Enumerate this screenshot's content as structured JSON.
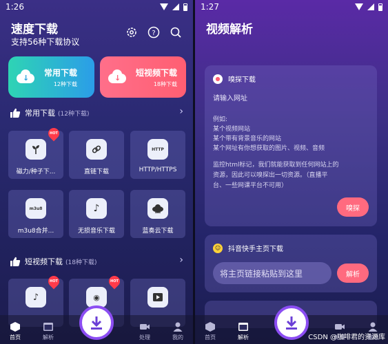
{
  "left": {
    "status": {
      "time": "1:26"
    },
    "header": {
      "title": "速度下载",
      "subtitle": "支持56种下载协议"
    },
    "header_icons": [
      "settings-icon",
      "help-icon",
      "search-icon"
    ],
    "big_cards": [
      {
        "title": "常用下载",
        "count": "12种下载",
        "color": "#2ed4b4"
      },
      {
        "title": "短视频下载",
        "count": "18种下载",
        "color": "#ff5e72"
      }
    ],
    "section1": {
      "title": "常用下载",
      "count": "(12种下载)"
    },
    "items_row1": [
      {
        "label": "磁力/种子下...",
        "icon": "sprout-icon",
        "hot": true
      },
      {
        "label": "直链下载",
        "icon": "link-icon",
        "hot": false
      },
      {
        "label": "HTTP/HTTPS",
        "icon": "http-icon",
        "icon_text": "HTTP",
        "hot": false
      }
    ],
    "items_row2": [
      {
        "label": "m3u8合并...",
        "icon": "m3u8-icon",
        "icon_text": "m3u8",
        "hot": false
      },
      {
        "label": "无损音乐下载",
        "icon": "music-icon",
        "hot": false
      },
      {
        "label": "蓝奏云下载",
        "icon": "cloud-icon",
        "hot": false
      }
    ],
    "section2": {
      "title": "短视频下载",
      "count": "(18种下载)"
    },
    "tabs": [
      {
        "label": "首页",
        "icon": "home-cube-icon",
        "active": true
      },
      {
        "label": "解析",
        "icon": "browser-icon",
        "active": false
      },
      {
        "label": "处理",
        "icon": "video-camera-icon",
        "active": false
      },
      {
        "label": "我的",
        "icon": "person-icon",
        "active": false
      }
    ]
  },
  "right": {
    "status": {
      "time": "1:27"
    },
    "header": {
      "title": "视频解析"
    },
    "sniff": {
      "title": "嗅探下载",
      "prompt": "请输入网址",
      "example_title": "例如:",
      "examples": [
        "某个视频网站",
        "某个带有背景音乐的网站",
        "某个网址有你想获取的图片、视频、音频"
      ],
      "monitor_lines": [
        "监控html标记，我们就能获取到任何网站上的",
        "资源，因此可以嗅探出一切资源。（直播平",
        "台、一些网课平台不可用）"
      ],
      "button": "嗅探"
    },
    "douyin": {
      "title": "抖音快手主页下载",
      "placeholder": "将主页链接粘贴到这里",
      "button": "解析"
    },
    "tabs": [
      {
        "label": "首页",
        "icon": "home-cube-icon",
        "active": false
      },
      {
        "label": "解析",
        "icon": "browser-icon",
        "active": true
      },
      {
        "label": "处理",
        "icon": "video-camera-icon",
        "active": false
      },
      {
        "label": "我的",
        "icon": "person-icon",
        "active": false
      }
    ],
    "watermark": "CSDN @咖啡君的资源库"
  }
}
